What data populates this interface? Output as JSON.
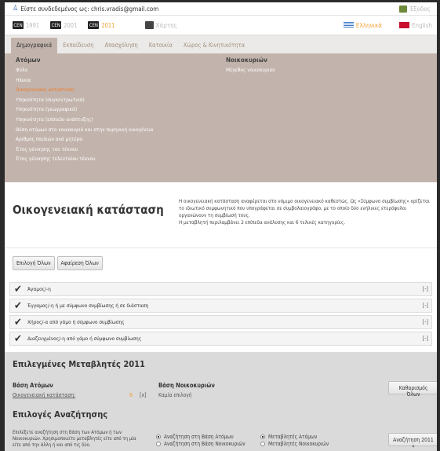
{
  "top": {
    "logged_in": "Είστε συνδεδεμένος ως: chris.vradis@gmail.com",
    "exit": "Έξοδος"
  },
  "census_years": [
    {
      "label": "1991",
      "active": false
    },
    {
      "label": "2001",
      "active": false
    },
    {
      "label": "2011",
      "active": true
    }
  ],
  "map_label": "Χάρτης",
  "languages": [
    {
      "label": "Ελληνικά",
      "selected": true
    },
    {
      "label": "English",
      "selected": false
    }
  ],
  "tabs": [
    "Δημογραφικά",
    "Εκπαίδευση",
    "Απασχόληση",
    "Κατοικία",
    "Χώρος & Κινητικότητα"
  ],
  "persons": {
    "header": "Ατόμων",
    "vars": [
      "Φύλο",
      "Ηλικία",
      "Οικογενειακή κατάσταση",
      "Υπηκοότητα (συγκεντρωτικά)",
      "Υπηκοότητα (γεωγραφικά)",
      "Υπηκοότητα (επίπεδο ανάπτυξης)",
      "Θέση ατόμων στο νοικοκυριό και στην πυρηνική οικογένεια",
      "Αριθμός παιδιών ανά μητέρα",
      "Έτος γέννησης του τέκνου",
      "Έτος γέννησης τελευταίου τέκνου"
    ],
    "current_index": 2
  },
  "households": {
    "header": "Νοικοκυριών",
    "vars": [
      "Μέγεθος νοικοκυριού"
    ]
  },
  "info": {
    "title": "Οικογενειακή κατάσταση",
    "desc1": "Η οικογενειακή κατάσταση αναφέρεται στο νόμιμο οικογενειακό καθεστώς. Ως «Σύμφωνο συμβίωσης» ορίζεται το ιδιωτικό συμφωνητικό που υπογράφεται σε συμβολαιογράφο, με το οποίο δύο ενήλικες ετερόφυλοι οργανώνουν τη συμβίωσή τους.",
    "desc2": "Η μεταβλητή περιλαμβάνει 2 επίπεδα ανάλυσης και 6 τελικές κατηγορίες."
  },
  "buttons": {
    "select_all": "Επιλογή Όλων",
    "remove_all": "Αφαίρεση Όλων",
    "clear_all": "Καθαρισμός Όλων",
    "search": "Αναζήτηση 2011 »"
  },
  "categories": [
    "Άγαμος/-η",
    "Έγγαμος/-η ή με σύμφωνο συμβίωσης ή σε διάσταση",
    "Χήρος/-α από γάμο ή σύμφωνο συμβίωσης",
    "Διαζευγμένος/-η από γάμο ή σύμφωνο συμβίωσης"
  ],
  "remove_mark": "[-]",
  "selected": {
    "title": "Επιλεγμένες Μεταβλητές 2011",
    "persons_label": "Βάση Ατόμων",
    "households_label": "Βάση Νοικοκυριών",
    "person_var": "Οικογενειακή κατάσταση",
    "person_count": "6",
    "remove": "[x]",
    "no_selection": "Καμία επιλογή"
  },
  "search_options": {
    "title": "Επιλογές Αναζήτησης",
    "desc": "Επιλέξετε αναζήτηση στη Βάση των Ατόμων ή των Νοικοκυριών. Χρησιμοποιείτε μεταβλητές είτε από τη μία είτε από την άλλη ή και από τις δύο.",
    "base_persons": "Αναζήτηση στη Βάση Ατόμων",
    "base_households": "Αναζήτηση στη Βάση Νοικοκυριών",
    "vars_persons": "Μεταβλητές Ατόμων",
    "vars_households": "Μεταβλητές Νοικοκυριών"
  }
}
